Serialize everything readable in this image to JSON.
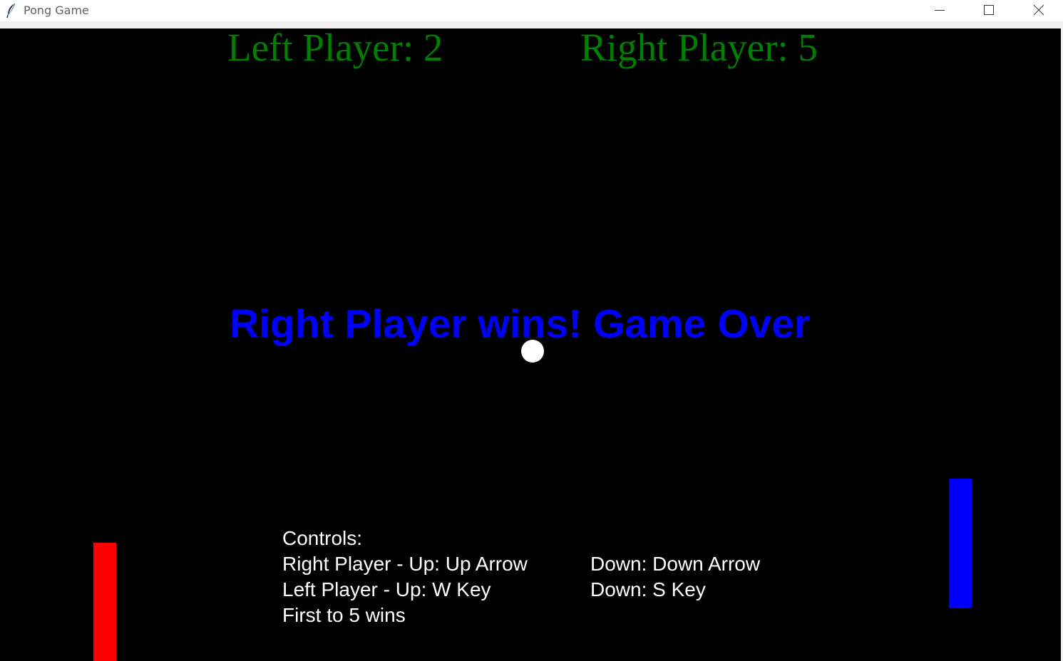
{
  "window": {
    "title": "Pong Game",
    "icon": "feather-icon",
    "controls": [
      "minimize-icon",
      "maximize-icon",
      "close-icon"
    ]
  },
  "scoreboard": {
    "left": "Left Player: 2",
    "right": "Right Player: 5",
    "color": "#008000"
  },
  "message": {
    "text": "Right Player wins! Game Over",
    "color": "#0000ff"
  },
  "controls": {
    "heading": "Controls:",
    "right_up": "Right Player - Up: Up Arrow",
    "right_down": "Down: Down Arrow",
    "left_up": "Left Player - Up: W Key",
    "left_down": "Down: S Key",
    "rule": "First to 5 wins"
  },
  "colors": {
    "background": "#000000",
    "left_paddle": "#ff0000",
    "right_paddle": "#0000ff",
    "ball": "#ffffff"
  }
}
